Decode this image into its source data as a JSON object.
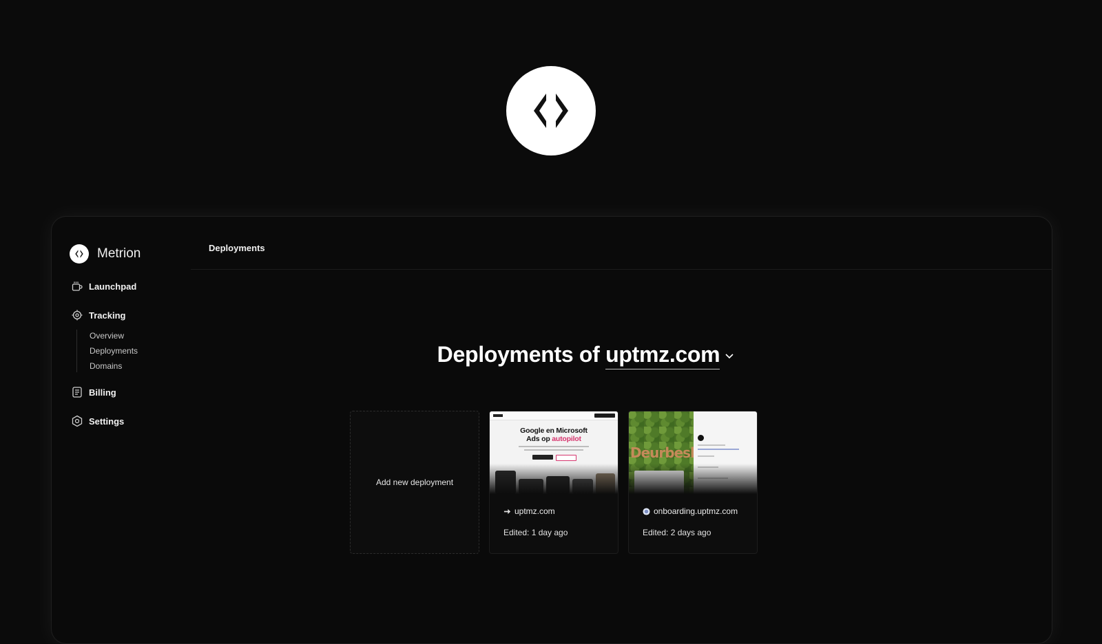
{
  "brand": {
    "name": "Metrion"
  },
  "sidebar": {
    "items": [
      {
        "label": "Launchpad",
        "icon": "coffee-cup-icon"
      },
      {
        "label": "Tracking",
        "icon": "target-icon"
      },
      {
        "label": "Billing",
        "icon": "receipt-icon"
      },
      {
        "label": "Settings",
        "icon": "gear-icon"
      }
    ],
    "tracking_sub": [
      "Overview",
      "Deployments",
      "Domains"
    ]
  },
  "header": {
    "title": "Deployments"
  },
  "main": {
    "title_prefix": "Deployments of",
    "domain": "uptmz.com"
  },
  "cards": {
    "add_label": "Add new deployment",
    "items": [
      {
        "site": "uptmz.com",
        "edited": "Edited: 1 day ago",
        "preview_headline_1": "Google en Microsoft",
        "preview_headline_2": "Ads op",
        "preview_headline_accent": "autopilot"
      },
      {
        "site": "onboarding.uptmz.com",
        "edited": "Edited: 2 days ago",
        "preview_sign": "Deurbesl"
      }
    ]
  },
  "colors": {
    "background": "#0b0b0b",
    "surface": "#0d0d0d",
    "text": "#ffffff",
    "accent_pink": "#d6356e"
  }
}
